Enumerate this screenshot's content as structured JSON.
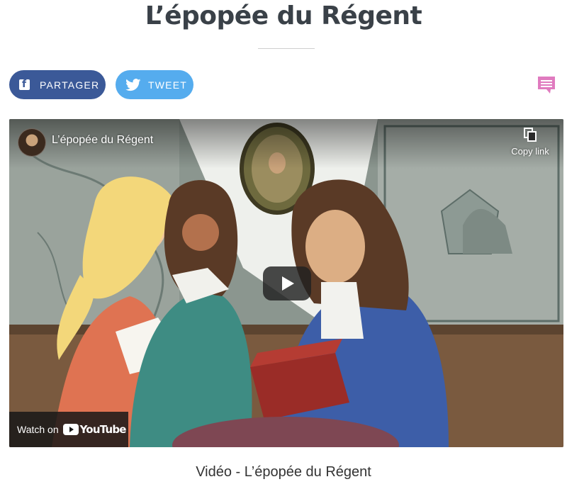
{
  "page": {
    "title": "L’épopée du Régent",
    "caption": "Vidéo - L’épopée du Régent"
  },
  "share": {
    "facebook_label": "PARTAGER",
    "twitter_label": "TWEET",
    "facebook_icon": "facebook-icon",
    "twitter_icon": "twitter-bird-icon",
    "comment_icon": "comment-icon",
    "colors": {
      "facebook": "#3b5998",
      "twitter": "#55acee",
      "comment": "#e07bbf"
    }
  },
  "video": {
    "title": "L’épopée du Régent",
    "copy_link_label": "Copy link",
    "watch_on_label": "Watch on",
    "youtube_label": "YouTube",
    "play_icon": "play-icon",
    "copy_icon": "copy-icon"
  }
}
